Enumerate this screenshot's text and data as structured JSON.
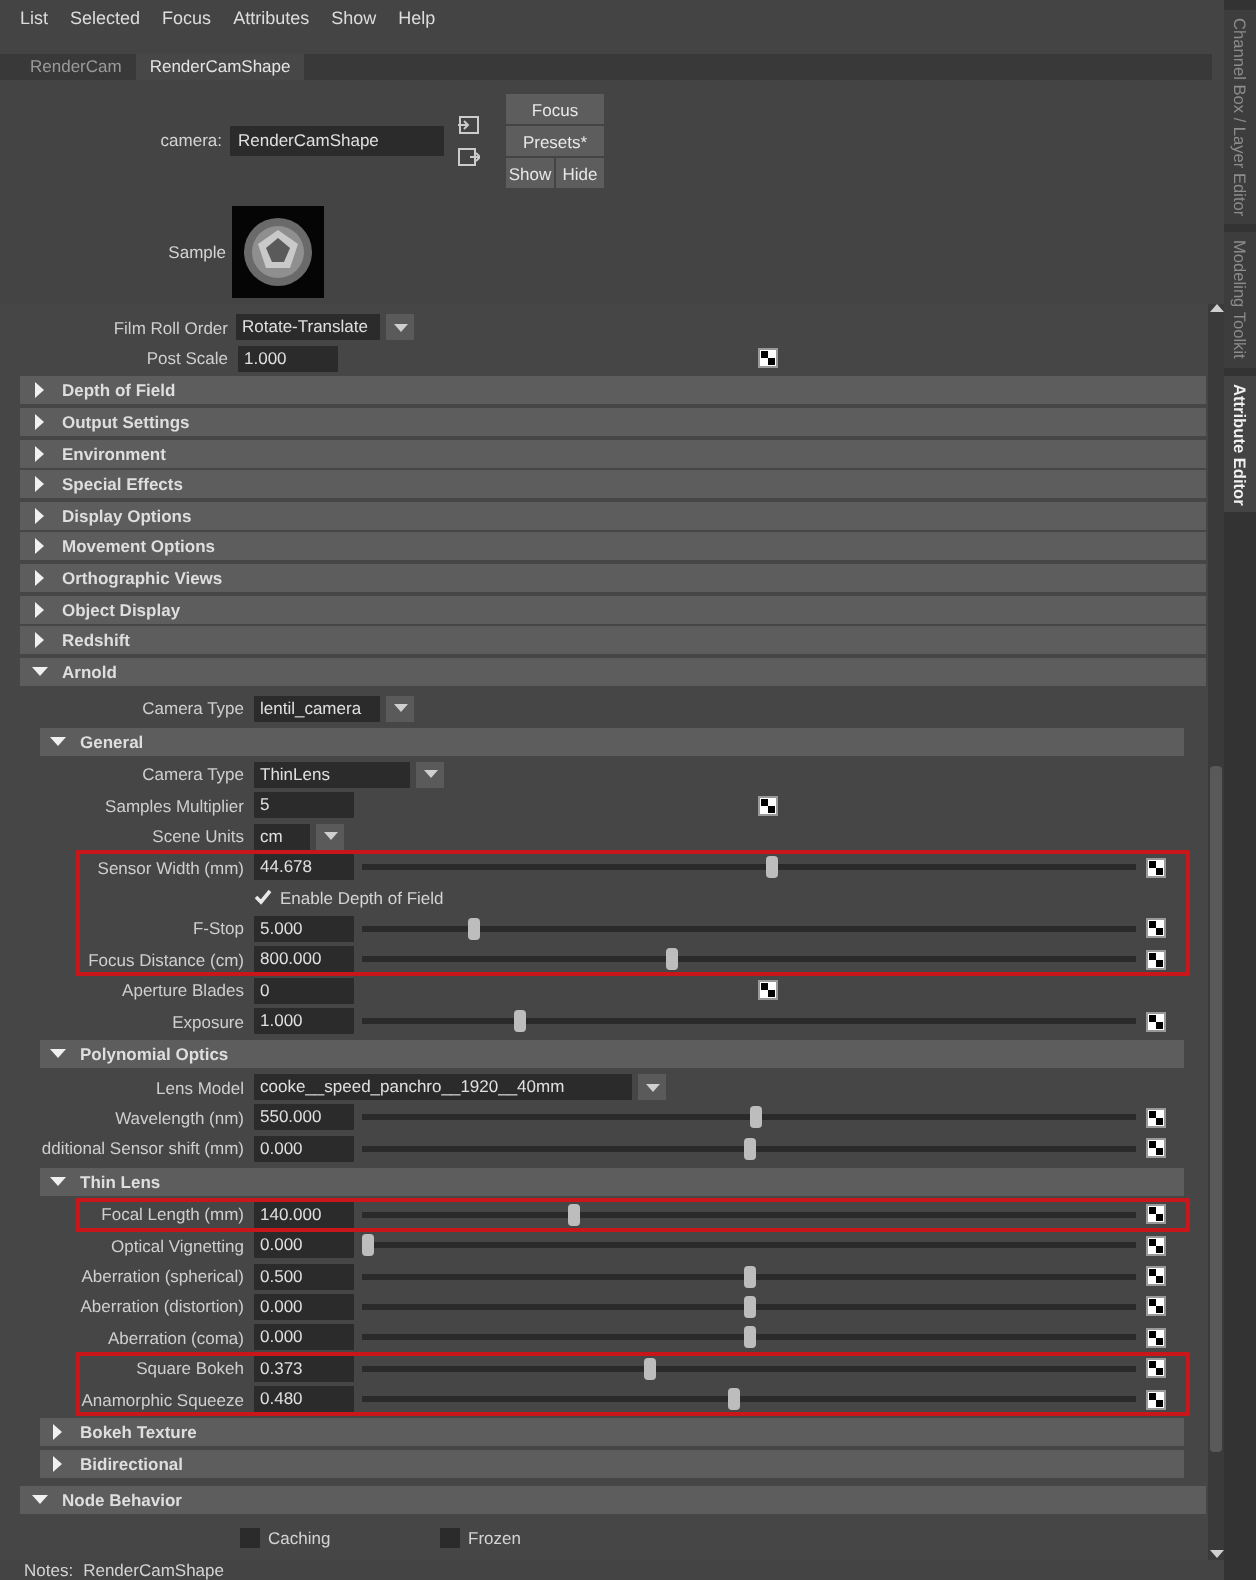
{
  "menu": [
    "List",
    "Selected",
    "Focus",
    "Attributes",
    "Show",
    "Help"
  ],
  "node_tabs": [
    {
      "label": "RenderCam",
      "selected": false
    },
    {
      "label": "RenderCamShape",
      "selected": true
    }
  ],
  "side_tabs": [
    {
      "label": "Channel Box / Layer Editor",
      "selected": false
    },
    {
      "label": "Modeling Toolkit",
      "selected": false
    },
    {
      "label": "Attribute Editor",
      "selected": true
    }
  ],
  "header": {
    "node_label": "camera:",
    "node_name": "RenderCamShape",
    "buttons": [
      "Focus",
      "Presets*"
    ],
    "toggle_buttons": [
      "Show",
      "Hide"
    ],
    "sample_label": "Sample"
  },
  "attributes": [
    {
      "kind": "dropdown",
      "label": "Film Roll Order",
      "value": "Rotate-Translate"
    },
    {
      "kind": "field",
      "label": "Post Scale",
      "value": "1.000",
      "mapped": true
    },
    {
      "kind": "section",
      "title": "Depth of Field",
      "expanded": false
    },
    {
      "kind": "section",
      "title": "Output Settings",
      "expanded": false
    },
    {
      "kind": "section",
      "title": "Environment",
      "expanded": false
    },
    {
      "kind": "section",
      "title": "Special Effects",
      "expanded": false
    },
    {
      "kind": "section",
      "title": "Display Options",
      "expanded": false
    },
    {
      "kind": "section",
      "title": "Movement Options",
      "expanded": false
    },
    {
      "kind": "section",
      "title": "Orthographic Views",
      "expanded": false
    },
    {
      "kind": "section",
      "title": "Object Display",
      "expanded": false
    },
    {
      "kind": "section",
      "title": "Redshift",
      "expanded": false
    },
    {
      "kind": "section",
      "title": "Arnold",
      "expanded": true,
      "children": [
        {
          "kind": "dropdown",
          "label": "Camera Type",
          "value": "lentil_camera"
        },
        {
          "kind": "section",
          "title": "General",
          "expanded": true,
          "children": [
            {
              "kind": "dropdown",
              "label": "Camera Type",
              "value": "ThinLens"
            },
            {
              "kind": "field",
              "label": "Samples Multiplier",
              "value": "5",
              "mapped": true
            },
            {
              "kind": "dropdown",
              "label": "Scene Units",
              "value": "cm"
            },
            {
              "kind": "highlight",
              "children": [
                {
                  "kind": "slider",
                  "label": "Sensor Width (mm)",
                  "value": "44.678",
                  "level": 0.53
                },
                {
                  "kind": "checkbox",
                  "label": "Enable Depth of Field",
                  "checked": true
                },
                {
                  "kind": "slider",
                  "label": "F-Stop",
                  "value": "5.000",
                  "level": 0.14
                },
                {
                  "kind": "slider",
                  "label": "Focus Distance (cm)",
                  "value": "800.000",
                  "level": 0.4
                }
              ]
            },
            {
              "kind": "field",
              "label": "Aperture Blades",
              "value": "0",
              "mapped": true
            },
            {
              "kind": "slider",
              "label": "Exposure",
              "value": "1.000",
              "level": 0.2
            }
          ]
        },
        {
          "kind": "section",
          "title": "Polynomial Optics",
          "expanded": true,
          "children": [
            {
              "kind": "dropdown",
              "label": "Lens Model",
              "value": "cooke__speed_panchro__1920__40mm"
            },
            {
              "kind": "slider",
              "label": "Wavelength (nm)",
              "value": "550.000",
              "level": 0.51
            },
            {
              "kind": "slider",
              "label": "dditional Sensor shift (mm)",
              "value": "0.000",
              "level": 0.5
            }
          ]
        },
        {
          "kind": "section",
          "title": "Thin Lens",
          "expanded": true,
          "children": [
            {
              "kind": "highlight",
              "children": [
                {
                  "kind": "slider",
                  "label": "Focal Length (mm)",
                  "value": "140.000",
                  "level": 0.27
                }
              ]
            },
            {
              "kind": "slider",
              "label": "Optical Vignetting",
              "value": "0.000",
              "level": 0
            },
            {
              "kind": "slider",
              "label": "Aberration (spherical)",
              "value": "0.500",
              "level": 0.5
            },
            {
              "kind": "slider",
              "label": "Aberration (distortion)",
              "value": "0.000",
              "level": 0.5
            },
            {
              "kind": "slider",
              "label": "Aberration (coma)",
              "value": "0.000",
              "level": 0.5
            },
            {
              "kind": "highlight",
              "children": [
                {
                  "kind": "slider",
                  "label": "Square Bokeh",
                  "value": "0.373",
                  "level": 0.37
                },
                {
                  "kind": "slider",
                  "label": "Anamorphic Squeeze",
                  "value": "0.480",
                  "level": 0.48
                }
              ]
            }
          ]
        },
        {
          "kind": "section",
          "title": "Bokeh Texture",
          "expanded": false
        },
        {
          "kind": "section",
          "title": "Bidirectional",
          "expanded": false
        }
      ]
    },
    {
      "kind": "section",
      "title": "Node Behavior",
      "expanded": true,
      "children": [
        {
          "kind": "checkboxes",
          "items": [
            {
              "label": "Caching",
              "checked": false
            },
            {
              "label": "Frozen",
              "checked": false
            }
          ]
        }
      ]
    }
  ],
  "notes": {
    "label": "Notes:",
    "value": "RenderCamShape"
  }
}
